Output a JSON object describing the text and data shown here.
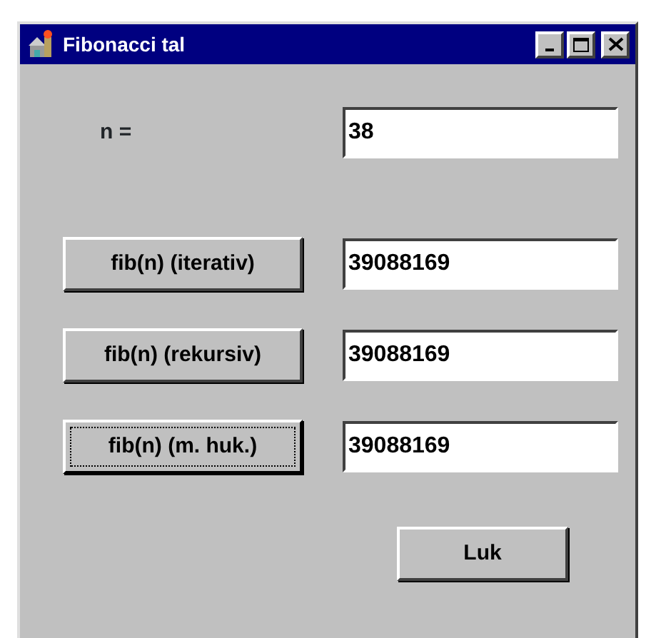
{
  "window": {
    "title": "Fibonacci tal"
  },
  "n_field": {
    "label": "n =",
    "value": "38"
  },
  "rows": [
    {
      "button": "fib(n) (iterativ)",
      "focused": false,
      "result": "39088169"
    },
    {
      "button": "fib(n) (rekursiv)",
      "focused": false,
      "result": "39088169"
    },
    {
      "button": "fib(n) (m. huk.)",
      "focused": true,
      "result": "39088169"
    }
  ],
  "close_button": "Luk"
}
